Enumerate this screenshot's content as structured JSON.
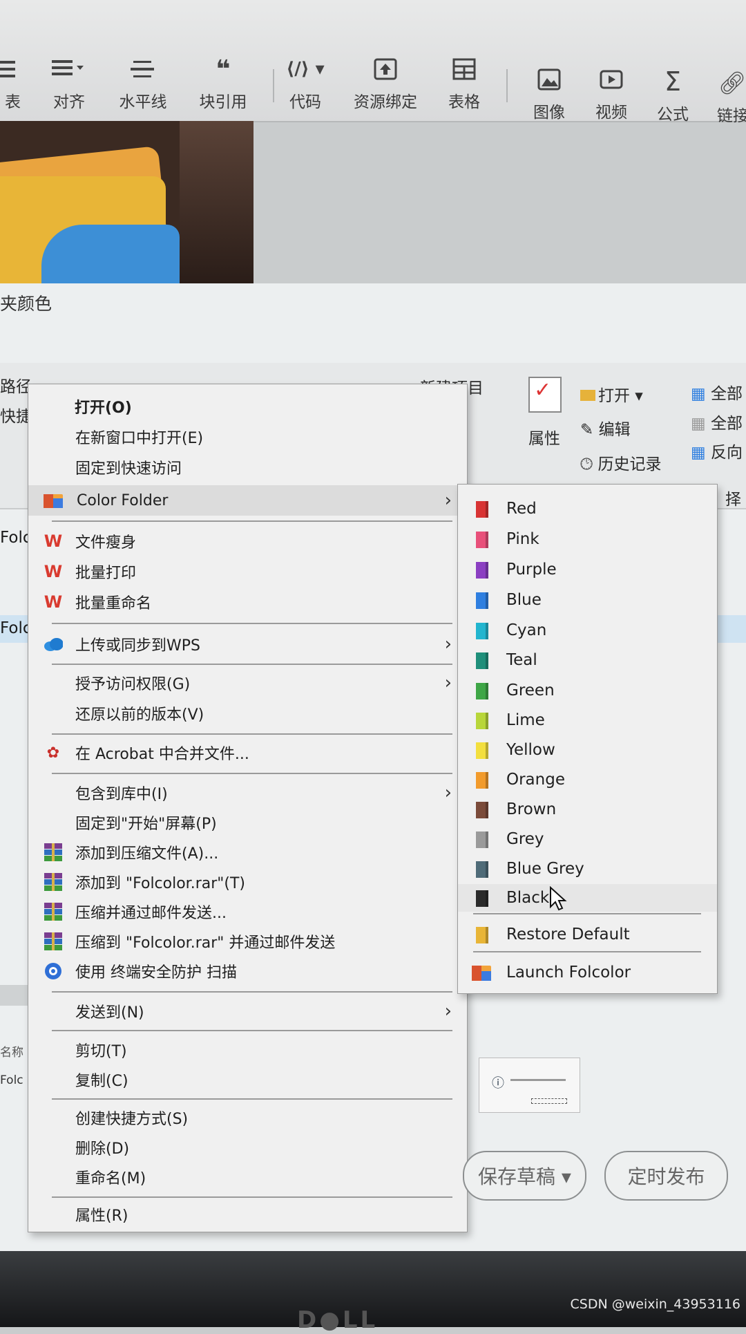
{
  "toolbar": {
    "items": [
      {
        "label": "表",
        "icon": "list-icon"
      },
      {
        "label": "对齐",
        "icon": "align-icon"
      },
      {
        "label": "水平线",
        "icon": "horizontal-rule-icon"
      },
      {
        "label": "块引用",
        "icon": "quote-icon"
      },
      {
        "label": "代码",
        "icon": "code-icon"
      },
      {
        "label": "资源绑定",
        "icon": "upload-icon"
      },
      {
        "label": "表格",
        "icon": "table-icon"
      },
      {
        "label": "图像",
        "icon": "image-icon"
      },
      {
        "label": "视频",
        "icon": "video-icon"
      },
      {
        "label": "公式",
        "icon": "sigma-icon"
      },
      {
        "label": "链接",
        "icon": "link-icon"
      }
    ]
  },
  "explorer": {
    "title": "夹颜色",
    "ribbon": {
      "left_path": "路径",
      "left_quick": "快捷",
      "new_item": "新建项目",
      "properties": "属性",
      "open": "打开",
      "edit": "编辑",
      "history": "历史记录",
      "select_all": "全部",
      "select_none": "全部",
      "invert": "反向",
      "select_label": "择"
    },
    "left_labels": [
      "Folc",
      "Folc"
    ],
    "name_col": "名称",
    "file_stub": "Folc"
  },
  "context_menu": {
    "open": "打开(O)",
    "open_new_window": "在新窗口中打开(E)",
    "pin_quick": "固定到快速访问",
    "color_folder": "Color Folder",
    "wps_slim": "文件瘦身",
    "wps_batch_print": "批量打印",
    "wps_batch_rename": "批量重命名",
    "wps_upload": "上传或同步到WPS",
    "grant_access": "授予访问权限(G)",
    "restore_versions": "还原以前的版本(V)",
    "acrobat_merge": "在 Acrobat 中合并文件...",
    "include_library": "包含到库中(I)",
    "pin_start": "固定到\"开始\"屏幕(P)",
    "add_archive": "添加到压缩文件(A)...",
    "add_to_rar": "添加到 \"Folcolor.rar\"(T)",
    "compress_email": "压缩并通过邮件发送...",
    "compress_rar_email": "压缩到 \"Folcolor.rar\" 并通过邮件发送",
    "security_scan": "使用 终端安全防护 扫描",
    "send_to": "发送到(N)",
    "cut": "剪切(T)",
    "copy": "复制(C)",
    "create_shortcut": "创建快捷方式(S)",
    "delete": "删除(D)",
    "rename": "重命名(M)",
    "properties": "属性(R)"
  },
  "color_submenu": {
    "colors": [
      {
        "name": "Red",
        "color": "#d83434"
      },
      {
        "name": "Pink",
        "color": "#e8507a"
      },
      {
        "name": "Purple",
        "color": "#8b3fc2"
      },
      {
        "name": "Blue",
        "color": "#2f7fe0"
      },
      {
        "name": "Cyan",
        "color": "#22b5cf"
      },
      {
        "name": "Teal",
        "color": "#1f8f7a"
      },
      {
        "name": "Green",
        "color": "#3ea646"
      },
      {
        "name": "Lime",
        "color": "#b8d63a"
      },
      {
        "name": "Yellow",
        "color": "#f3df3e"
      },
      {
        "name": "Orange",
        "color": "#f29b2c"
      },
      {
        "name": "Brown",
        "color": "#7b4b3a"
      },
      {
        "name": "Grey",
        "color": "#9a9a9a"
      },
      {
        "name": "Blue Grey",
        "color": "#4f6b78"
      },
      {
        "name": "Black",
        "color": "#2b2b2b"
      }
    ],
    "restore_default": "Restore Default",
    "launch": "Launch Folcolor"
  },
  "bottom": {
    "save_draft": "保存草稿 ▾",
    "schedule_publish": "定时发布"
  },
  "watermark": "CSDN @weixin_43953116"
}
